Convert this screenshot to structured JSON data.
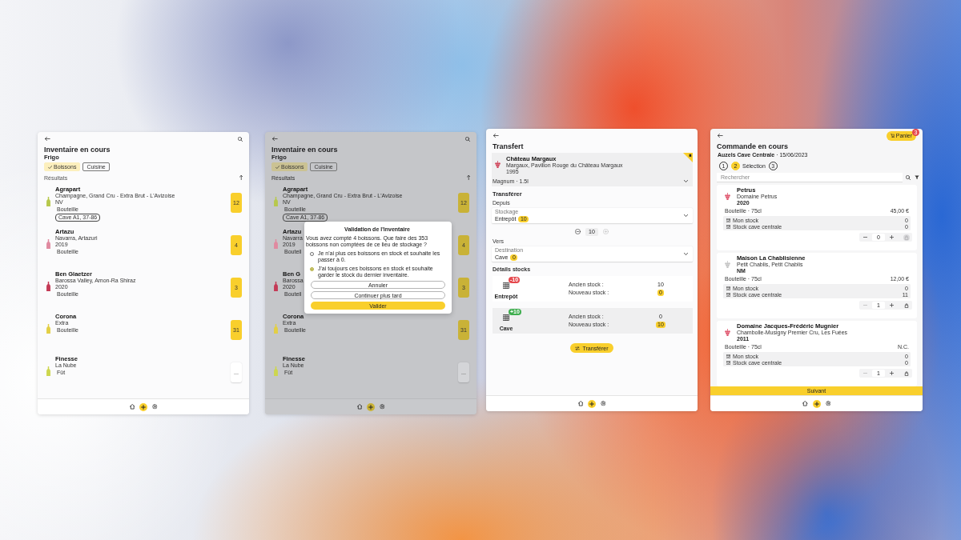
{
  "inventory_screen": {
    "title": "Inventaire en cours",
    "location": "Frigo",
    "filters": [
      {
        "label": "Boissons",
        "selected": true
      },
      {
        "label": "Cuisine",
        "selected": false
      }
    ],
    "results_label": "Résultats",
    "items": [
      {
        "name": "Agrapart",
        "details": "Champagne, Grand Cru - Extra Brut - L'Avizoise",
        "year": "NV",
        "format": "Bouteille",
        "location_tag": "Cave A1, 37-86",
        "count": "12",
        "counted": true,
        "color": "#b7c84c"
      },
      {
        "name": "Artazu",
        "details": "Navarra, Artazuri",
        "year": "2019",
        "format": "Bouteille",
        "count": "4",
        "counted": true,
        "color": "#e08aa0"
      },
      {
        "name": "Ben Glaetzer",
        "details": "Barossa Valley, Amon-Ra Shiraz",
        "year": "2020",
        "format": "Bouteille",
        "count": "3",
        "counted": true,
        "color": "#c43a56"
      },
      {
        "name": "Corona",
        "details": "Extra",
        "format": "Bouteille",
        "count": "31",
        "counted": true,
        "color": "#e3cf45"
      },
      {
        "name": "Finesse",
        "details": "La Nube",
        "format": "Fût",
        "count": "...",
        "counted": false,
        "color": "#cdd64e"
      }
    ]
  },
  "validation_screen": {
    "title": "Inventaire en cours",
    "location": "Frigo",
    "filters": [
      {
        "label": "Boissons",
        "selected": true
      },
      {
        "label": "Cuisine",
        "selected": false
      }
    ],
    "results_label": "Résultats",
    "items": [
      {
        "name": "Agrapart",
        "details": "Champagne, Grand Cru - Extra Brut - L'Avizoise",
        "year": "NV",
        "format": "Bouteille",
        "location_tag": "Cave A1, 37-86",
        "count": "12",
        "counted": true,
        "color": "#b7c84c"
      },
      {
        "name": "Artazu",
        "details": "Navarra",
        "year": "2019",
        "format": "Bouteil",
        "count": "4",
        "counted": true,
        "color": "#e08aa0"
      },
      {
        "name": "Ben G",
        "details": "Barossa",
        "year": "2020",
        "format": "Bouteil",
        "count": "3",
        "counted": true,
        "color": "#c43a56"
      },
      {
        "name": "Corona",
        "details": "Extra",
        "format": "Bouteille",
        "count": "31",
        "counted": true,
        "color": "#e3cf45"
      },
      {
        "name": "Finesse",
        "details": "La Nube",
        "format": "Fût",
        "count": "...",
        "counted": false,
        "color": "#cdd64e"
      }
    ],
    "dialog": {
      "title": "Validation de l'inventaire",
      "message": "Vous avez compté 4 boissons. Que faire des 353 boissons non comptées de ce lieu de stockage ?",
      "options": [
        {
          "label": "Je n'ai plus ces boissons en stock et souhaite les passer à 0.",
          "selected": false
        },
        {
          "label": "J'ai toujours ces boissons en stock et souhaite garder le stock du dernier inventaire.",
          "selected": true
        }
      ],
      "buttons": [
        {
          "label": "Annuler",
          "kind": "outline"
        },
        {
          "label": "Continuer plus tard",
          "kind": "outline"
        },
        {
          "label": "Valider",
          "kind": "primary"
        }
      ]
    }
  },
  "transfer_screen": {
    "title": "Transfert",
    "product": {
      "name": "Château Margaux",
      "details": "Margaux, Pavillon Rouge du Château Margaux",
      "year": "1995",
      "color": "#d0455a",
      "format": "Magnum · 1.5l"
    },
    "section_title": "Transférer",
    "from": {
      "label": "Depuis",
      "field_label": "Stockage",
      "value": "Entrepôt",
      "badge": "10"
    },
    "quantity": {
      "value": "10",
      "increase_disabled": true
    },
    "to": {
      "label": "Vers",
      "field_label": "Destination",
      "value": "Cave",
      "badge": "0"
    },
    "stock_title": "Détails stocks",
    "stocks": [
      {
        "name": "Entrepôt",
        "change": "-10",
        "color": "#e5484d",
        "old_label": "Ancien stock :",
        "old_value": "10",
        "new_label": "Nouveau stock :",
        "new_value": "0",
        "selected": false
      },
      {
        "name": "Cave",
        "change": "+10",
        "color": "#3fae4f",
        "old_label": "Ancien stock :",
        "old_value": "0",
        "new_label": "Nouveau stock :",
        "new_value": "10",
        "selected": true
      }
    ],
    "button": "Transférer"
  },
  "order_screen": {
    "title": "Commande en cours",
    "cart": {
      "label": "Panier",
      "badge": "3"
    },
    "subtitle": "**Auzels Cave Centrale** · 15/06/2023",
    "steps": [
      {
        "number": "1",
        "selected": false
      },
      {
        "number": "2",
        "label": "Sélection",
        "selected": true
      },
      {
        "number": "3",
        "selected": false
      }
    ],
    "search": {
      "placeholder": "Rechercher"
    },
    "products": [
      {
        "name": "Petrus",
        "details": "Domaine Petrus",
        "year": "2020",
        "color": "#e0566e",
        "format": "Bouteille · 75cl",
        "price": "45,00 €",
        "stocks": [
          {
            "label": "Mon stock",
            "value": "0"
          },
          {
            "label": "Stock cave centrale",
            "value": "0"
          }
        ],
        "quantity": "0",
        "decrease_disabled": false,
        "cart_disabled": true
      },
      {
        "name": "Maison La Chablisienne",
        "details": "Petit Chablis, Petit Chablis",
        "year": "NM",
        "color": "#c4c4c4",
        "format": "Bouteille · 75cl",
        "price": "12,00 €",
        "stocks": [
          {
            "label": "Mon stock",
            "value": "0"
          },
          {
            "label": "Stock cave centrale",
            "value": "11"
          }
        ],
        "quantity": "1",
        "decrease_disabled": true,
        "cart_disabled": false
      },
      {
        "name": "Domaine Jacques-Frédéric Mugnier",
        "details": "Chambolle-Musigny Premier Cru, Les Fuées",
        "year": "2011",
        "color": "#e0566e",
        "format": "Bouteille · 75cl",
        "price": "N.C.",
        "stocks": [
          {
            "label": "Mon stock",
            "value": "0"
          },
          {
            "label": "Stock cave centrale",
            "value": "0"
          }
        ],
        "quantity": "1",
        "decrease_disabled": true,
        "cart_disabled": false
      }
    ],
    "next_button": "Suivant"
  }
}
